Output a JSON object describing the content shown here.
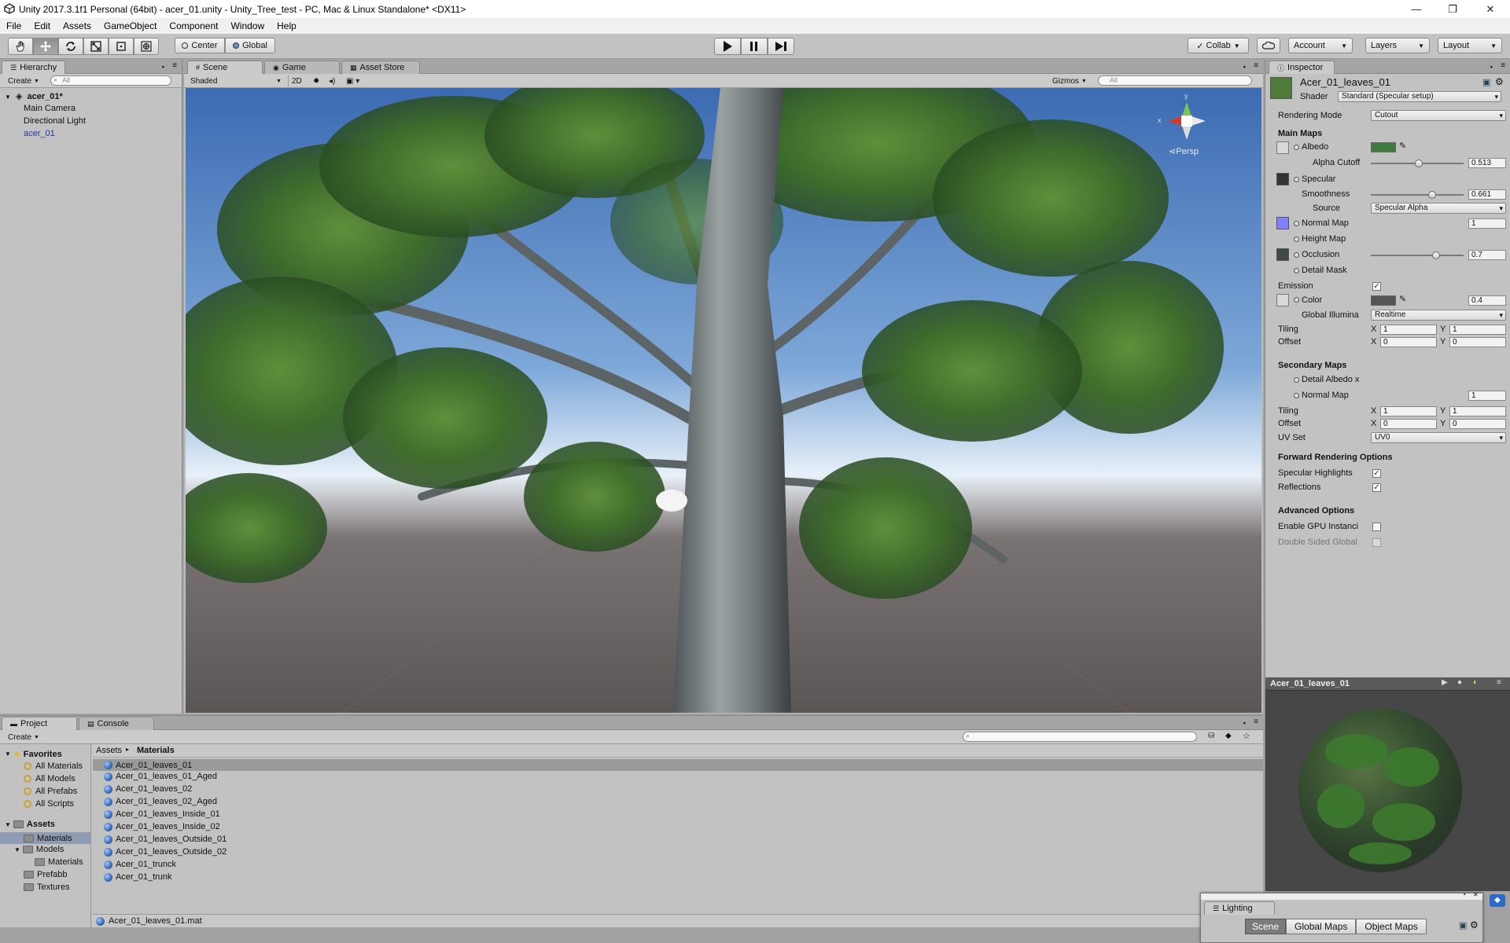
{
  "window": {
    "title": "Unity 2017.3.1f1 Personal (64bit) - acer_01.unity - Unity_Tree_test - PC, Mac & Linux Standalone* <DX11>",
    "minimize": "—",
    "maximize": "❐",
    "close": "✕"
  },
  "menu": [
    "File",
    "Edit",
    "Assets",
    "GameObject",
    "Component",
    "Window",
    "Help"
  ],
  "toolbar": {
    "pivot": "Center",
    "space": "Global",
    "collab": "Collab",
    "account": "Account",
    "layers": "Layers",
    "layout": "Layout"
  },
  "hierarchy": {
    "tab": "Hierarchy",
    "create": "Create",
    "search_placeholder": "All",
    "scene": "acer_01*",
    "items": [
      "Main Camera",
      "Directional Light",
      "acer_01"
    ]
  },
  "scene_view": {
    "tabs": [
      "Scene",
      "Game",
      "Asset Store"
    ],
    "shading": "Shaded",
    "mode_2d": "2D",
    "gizmos": "Gizmos",
    "search_placeholder": "All",
    "gizmo_axis_x": "x",
    "gizmo_axis_y": "y",
    "persp": "Persp"
  },
  "inspector": {
    "tab": "Inspector",
    "material_name": "Acer_01_leaves_01",
    "shader_label": "Shader",
    "shader_value": "Standard (Specular setup)",
    "rendering_mode_label": "Rendering Mode",
    "rendering_mode_value": "Cutout",
    "main_maps": "Main Maps",
    "albedo": "Albedo",
    "albedo_color": "#3f7a40",
    "alpha_cutoff_label": "Alpha Cutoff",
    "alpha_cutoff": "0.513",
    "specular": "Specular",
    "specular_color": "#333333",
    "smoothness_label": "Smoothness",
    "smoothness": "0.661",
    "source_label": "Source",
    "source_value": "Specular Alpha",
    "normal_map": "Normal Map",
    "normal_map_value": "1",
    "height_map": "Height Map",
    "occlusion": "Occlusion",
    "occlusion_value": "0.7",
    "detail_mask": "Detail Mask",
    "emission": "Emission",
    "color_label": "Color",
    "emission_color": "#555555",
    "color_value": "0.4",
    "global_illum_label": "Global Illumina",
    "global_illum_value": "Realtime",
    "tiling": "Tiling",
    "offset": "Offset",
    "x": "X",
    "y": "Y",
    "tiling_x": "1",
    "tiling_y": "1",
    "offset_x": "0",
    "offset_y": "0",
    "secondary_maps": "Secondary Maps",
    "detail_albedo": "Detail Albedo x",
    "sec_normal_map": "Normal Map",
    "sec_normal_value": "1",
    "sec_tiling_x": "1",
    "sec_tiling_y": "1",
    "sec_offset_x": "0",
    "sec_offset_y": "0",
    "uv_set_label": "UV Set",
    "uv_set_value": "UV0",
    "forward_options": "Forward Rendering Options",
    "specular_highlights": "Specular Highlights",
    "reflections": "Reflections",
    "advanced_options": "Advanced Options",
    "gpu_instancing": "Enable GPU Instanci",
    "double_sided": "Double Sided Global",
    "alpha_cutoff_fraction": 0.513,
    "smoothness_fraction": 0.661,
    "occlusion_fraction": 0.7
  },
  "preview": {
    "title": "Acer_01_leaves_01"
  },
  "project": {
    "tabs": [
      "Project",
      "Console"
    ],
    "create": "Create",
    "favorites": "Favorites",
    "favorite_items": [
      "All Materials",
      "All Models",
      "All Prefabs",
      "All Scripts"
    ],
    "assets": "Assets",
    "asset_tree": [
      "Materials",
      "Models",
      "Materials",
      "Prefabb",
      "Textures"
    ],
    "breadcrumb": [
      "Assets",
      "Materials"
    ],
    "files": [
      "Acer_01_leaves_01",
      "Acer_01_leaves_01_Aged",
      "Acer_01_leaves_02",
      "Acer_01_leaves_02_Aged",
      "Acer_01_leaves_Inside_01",
      "Acer_01_leaves_Inside_02",
      "Acer_01_leaves_Outside_01",
      "Acer_01_leaves_Outside_02",
      "Acer_01_trunck",
      "Acer_01_trunk"
    ],
    "selected_path": "Acer_01_leaves_01.mat"
  },
  "lighting": {
    "title": "Lighting",
    "tabs": [
      "Scene",
      "Global Maps",
      "Object Maps"
    ]
  }
}
